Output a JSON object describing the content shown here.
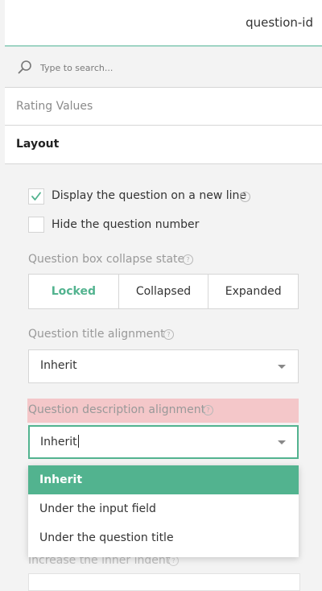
{
  "header": {
    "title": "question-id"
  },
  "search": {
    "placeholder": "Type to search..."
  },
  "categories": [
    {
      "label": "Rating Values"
    },
    {
      "label": "Layout"
    }
  ],
  "layout": {
    "checkboxes": [
      {
        "label": "Display the question on a new line",
        "checked": true,
        "help": "?"
      },
      {
        "label": "Hide the question number",
        "checked": false
      }
    ],
    "collapse_state": {
      "title": "Question box collapse state",
      "help": "?",
      "options": [
        "Locked",
        "Collapsed",
        "Expanded"
      ],
      "selected": "Locked"
    },
    "title_alignment": {
      "title": "Question title alignment",
      "help": "?",
      "value": "Inherit"
    },
    "description_alignment": {
      "title": "Question description alignment",
      "help": "?",
      "value": "Inherit",
      "options": [
        "Inherit",
        "Under the input field",
        "Under the question title"
      ],
      "selected": "Inherit"
    },
    "inner_indent": {
      "title": "Increase the inner indent",
      "help": "?"
    }
  },
  "colors": {
    "accent": "#52b38f",
    "highlight_error": "#f4c7c9",
    "header_border": "#9fd4c4"
  }
}
